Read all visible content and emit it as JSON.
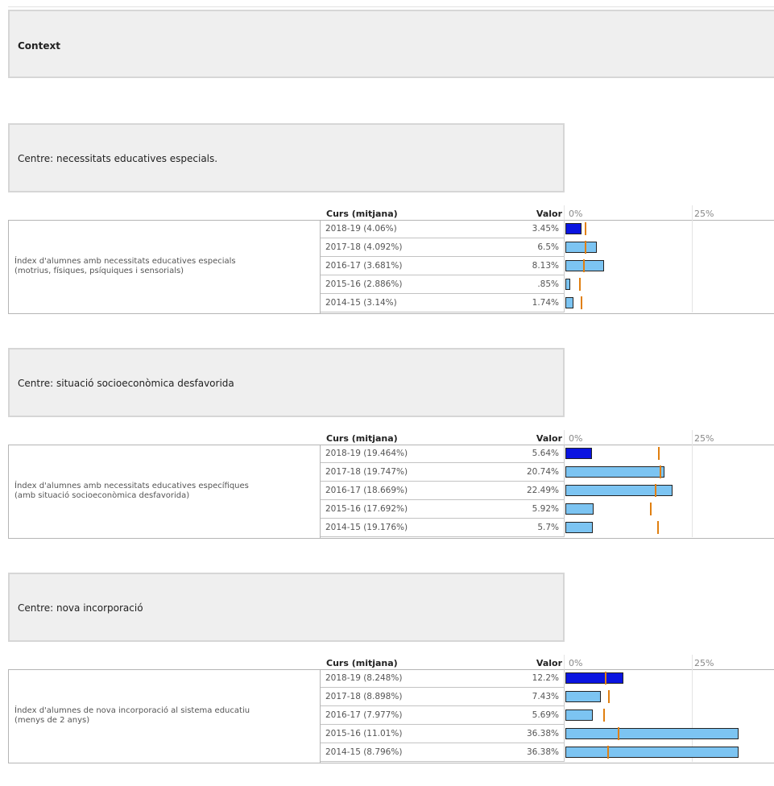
{
  "context": {
    "title": "Context"
  },
  "scale": {
    "min_label": "0%",
    "mid_label": "25%",
    "max_value": 39
  },
  "colors": {
    "current_bar": "#0a14e0",
    "past_bar": "#7cc4f2",
    "mean_marker": "#e07f10"
  },
  "headers": {
    "curs": "Curs (mitjana)",
    "valor": "Valor"
  },
  "sections": [
    {
      "title": "Centre: necessitats educatives especials.",
      "indicator": [
        "Índex d'alumnes amb necessitats educatives especials",
        "(motrius, físiques, psíquiques i sensorials)"
      ],
      "rows": [
        {
          "curs": "2018-19 (4.06%)",
          "valor": "3.45%",
          "value": 3.45,
          "mean": 4.06,
          "current": true
        },
        {
          "curs": "2017-18 (4.092%)",
          "valor": "6.5%",
          "value": 6.5,
          "mean": 4.092,
          "current": false
        },
        {
          "curs": "2016-17 (3.681%)",
          "valor": "8.13%",
          "value": 8.13,
          "mean": 3.681,
          "current": false
        },
        {
          "curs": "2015-16 (2.886%)",
          "valor": ".85%",
          "value": 0.85,
          "mean": 2.886,
          "current": false
        },
        {
          "curs": "2014-15 (3.14%)",
          "valor": "1.74%",
          "value": 1.74,
          "mean": 3.14,
          "current": false
        }
      ]
    },
    {
      "title": "Centre: situació socioeconòmica desfavorida",
      "indicator": [
        "Índex d'alumnes amb necessitats educatives específiques",
        "(amb situació socioeconòmica desfavorida)"
      ],
      "rows": [
        {
          "curs": "2018-19 (19.464%)",
          "valor": "5.64%",
          "value": 5.64,
          "mean": 19.464,
          "current": true
        },
        {
          "curs": "2017-18 (19.747%)",
          "valor": "20.74%",
          "value": 20.74,
          "mean": 19.747,
          "current": false
        },
        {
          "curs": "2016-17 (18.669%)",
          "valor": "22.49%",
          "value": 22.49,
          "mean": 18.669,
          "current": false
        },
        {
          "curs": "2015-16 (17.692%)",
          "valor": "5.92%",
          "value": 5.92,
          "mean": 17.692,
          "current": false
        },
        {
          "curs": "2014-15 (19.176%)",
          "valor": "5.7%",
          "value": 5.7,
          "mean": 19.176,
          "current": false
        }
      ]
    },
    {
      "title": "Centre: nova incorporació",
      "indicator": [
        "Índex d'alumnes de nova incorporació al sistema educatiu",
        "(menys de 2 anys)"
      ],
      "rows": [
        {
          "curs": "2018-19 (8.248%)",
          "valor": "12.2%",
          "value": 12.2,
          "mean": 8.248,
          "current": true
        },
        {
          "curs": "2017-18 (8.898%)",
          "valor": "7.43%",
          "value": 7.43,
          "mean": 8.898,
          "current": false
        },
        {
          "curs": "2016-17 (7.977%)",
          "valor": "5.69%",
          "value": 5.69,
          "mean": 7.977,
          "current": false
        },
        {
          "curs": "2015-16 (11.01%)",
          "valor": "36.38%",
          "value": 36.38,
          "mean": 11.01,
          "current": false
        },
        {
          "curs": "2014-15 (8.796%)",
          "valor": "36.38%",
          "value": 36.38,
          "mean": 8.796,
          "current": false
        }
      ]
    }
  ]
}
